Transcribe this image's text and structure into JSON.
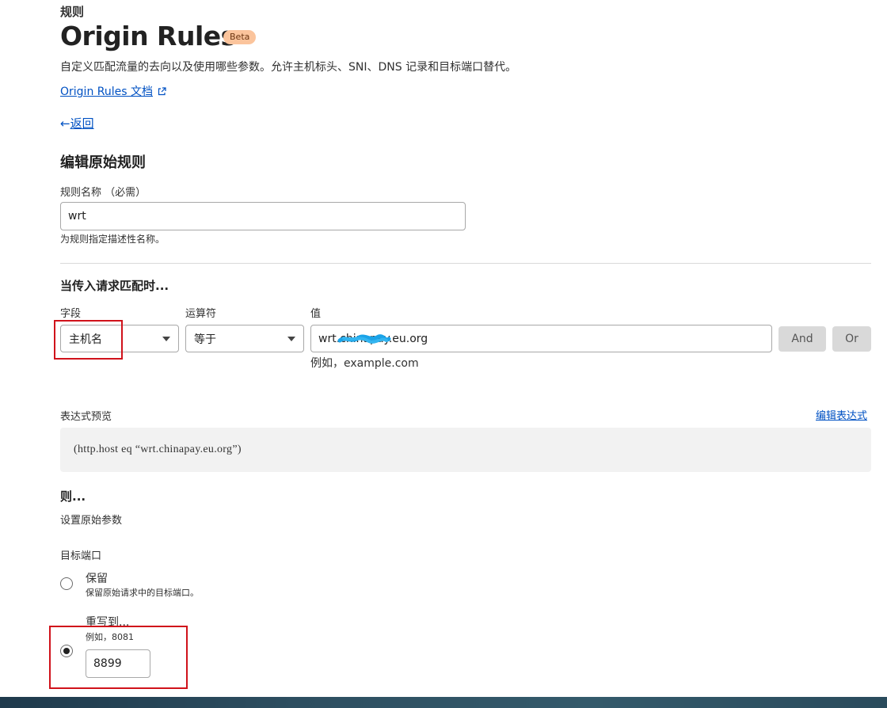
{
  "header": {
    "breadcrumb": "规则",
    "title": "Origin Rules",
    "badge": "Beta",
    "description": "自定义匹配流量的去向以及使用哪些参数。允许主机标头、SNI、DNS 记录和目标端口替代。",
    "doc_link": "Origin Rules 文档",
    "back_label": "返回",
    "back_arrow": "←"
  },
  "form": {
    "section_title": "编辑原始规则",
    "rule_name": {
      "label": "规则名称 （必需）",
      "value": "wrt",
      "help": "为规则指定描述性名称。"
    },
    "match": {
      "title": "当传入请求匹配时...",
      "field_label": "字段",
      "field_value": "主机名",
      "operator_label": "运算符",
      "operator_value": "等于",
      "value_label": "值",
      "value_value": "wrt.chinapay.eu.org",
      "value_help": "例如，example.com",
      "and_label": "And",
      "or_label": "Or"
    },
    "expression": {
      "label": "表达式预览",
      "edit_link": "编辑表达式",
      "text": "(http.host eq “wrt.chinapay.eu.org”)"
    },
    "then": {
      "title": "则...",
      "subtitle": "设置原始参数",
      "dest_port_label": "目标端口",
      "preserve_label": "保留",
      "preserve_help": "保留原始请求中的目标端口。",
      "rewrite_label": "重写到...",
      "rewrite_help": "例如，8081",
      "rewrite_value": "8899",
      "selected": "rewrite"
    }
  },
  "colors": {
    "link": "#0051c3",
    "badge_bg": "#fbc49c",
    "highlight": "#d0121b",
    "redaction": "#1aa3e8"
  }
}
